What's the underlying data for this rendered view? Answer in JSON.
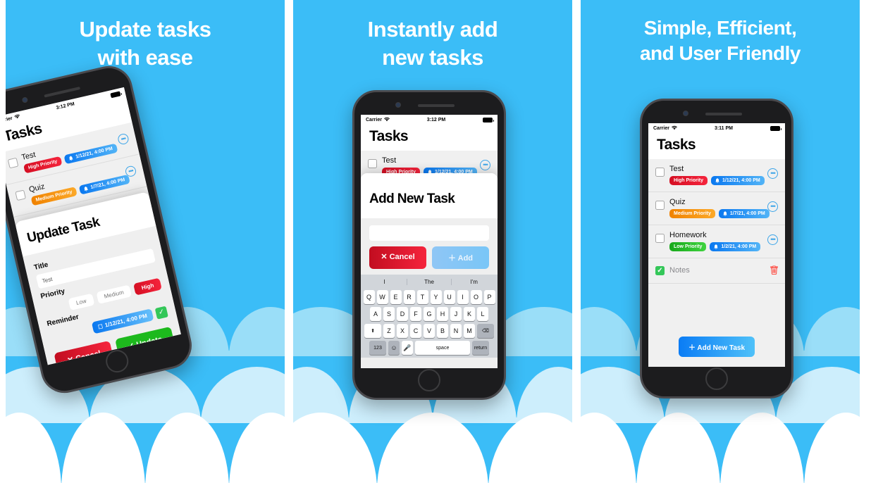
{
  "brand": {
    "sky": "#3bbdf7",
    "cloud1": "#9adef8",
    "cloud2": "#cdeefc",
    "cloud3": "#ffffff"
  },
  "panels": [
    {
      "id": "panel-update-tasks",
      "headline_line1": "Update tasks",
      "headline_line2": "with ease"
    },
    {
      "id": "panel-add-tasks",
      "headline_line1": "Instantly add",
      "headline_line2": "new tasks"
    },
    {
      "id": "panel-simple-efficient",
      "headline_line1": "Simple, Efficient,",
      "headline_line2": "and User Friendly"
    }
  ],
  "status_bar": {
    "carrier": "Carrier",
    "wifi_icon": "wifi-icon",
    "time_1": "3:12 PM",
    "time_2": "3:12 PM",
    "time_3": "3:11 PM",
    "battery_icon": "battery-full-icon"
  },
  "nav": {
    "title": "Tasks"
  },
  "tasks": {
    "phone1": [
      {
        "name": "Test",
        "priority": "High Priority",
        "priority_level": "high",
        "date": "1/12/21, 4:00 PM",
        "checked": false,
        "action": "more-icon"
      },
      {
        "name": "Quiz",
        "priority": "Medium Priority",
        "priority_level": "med",
        "date": "1/7/21, 4:00 PM",
        "checked": false,
        "action": "more-icon"
      }
    ],
    "phone2": [
      {
        "name": "Test",
        "priority": "High Priority",
        "priority_level": "high",
        "date": "1/12/21, 4:00 PM",
        "checked": false,
        "action": "more-icon"
      }
    ],
    "phone3": [
      {
        "name": "Test",
        "priority": "High Priority",
        "priority_level": "high",
        "date": "1/12/21, 4:00 PM",
        "checked": false,
        "action": "more-icon"
      },
      {
        "name": "Quiz",
        "priority": "Medium Priority",
        "priority_level": "med",
        "date": "1/7/21, 4:00 PM",
        "checked": false,
        "action": "more-icon"
      },
      {
        "name": "Homework",
        "priority": "Low Priority",
        "priority_level": "low",
        "date": "1/2/21, 4:00 PM",
        "checked": false,
        "action": "more-icon"
      },
      {
        "name": "Notes",
        "priority": null,
        "priority_level": null,
        "date": null,
        "checked": true,
        "action": "trash-icon"
      }
    ]
  },
  "update_sheet": {
    "title": "Update Task",
    "title_label": "Title",
    "title_value": "Test",
    "priority_label": "Priority",
    "priority_options": [
      "Low",
      "Medium",
      "High"
    ],
    "priority_selected": "High",
    "reminder_label": "Reminder",
    "reminder_value": "1/12/21, 4:00 PM",
    "reminder_confirm_icon": "check-icon",
    "cancel_label": "Cancel",
    "cancel_icon": "close-icon",
    "submit_label": "Update",
    "submit_icon": "check-icon"
  },
  "add_sheet": {
    "title": "Add New Task",
    "input_value": "",
    "input_placeholder": "",
    "cancel_label": "Cancel",
    "cancel_icon": "close-icon",
    "submit_label": "Add",
    "submit_icon": "plus-icon"
  },
  "add_new_task_button": {
    "label": "Add New Task",
    "icon": "plus-icon"
  },
  "keyboard": {
    "predictions": [
      "I",
      "The",
      "I'm"
    ],
    "row1": [
      "Q",
      "W",
      "E",
      "R",
      "T",
      "Y",
      "U",
      "I",
      "O",
      "P"
    ],
    "row2": [
      "A",
      "S",
      "D",
      "F",
      "G",
      "H",
      "J",
      "K",
      "L"
    ],
    "row3": [
      "Z",
      "X",
      "C",
      "V",
      "B",
      "N",
      "M"
    ],
    "shift_icon": "shift-icon",
    "backspace_icon": "backspace-icon",
    "numeric_label": "123",
    "emoji_icon": "emoji-icon",
    "mic_icon": "microphone-icon",
    "space_label": "space",
    "return_label": "return"
  },
  "icons": {
    "bell": "bell-icon",
    "more": "more-horizontal-icon",
    "trash": "trash-icon",
    "calendar": "calendar-icon"
  }
}
